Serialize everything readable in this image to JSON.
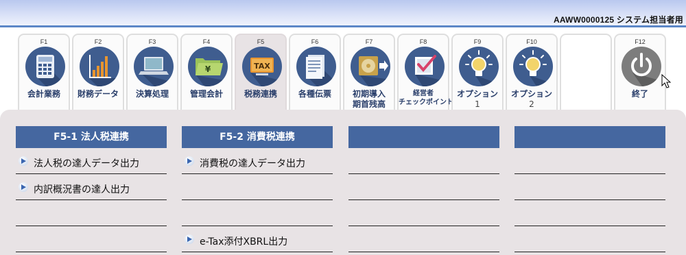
{
  "header": {
    "info": "AAWW0000125 システム担当者用"
  },
  "tabs": [
    {
      "key": "F1",
      "label": "会計業務",
      "icon": "calculator-icon"
    },
    {
      "key": "F2",
      "label": "財務データ",
      "icon": "bar-chart-icon"
    },
    {
      "key": "F3",
      "label": "決算処理",
      "icon": "laptop-icon"
    },
    {
      "key": "F4",
      "label": "管理会計",
      "icon": "yen-folder-icon"
    },
    {
      "key": "F5",
      "label": "税務連携",
      "icon": "tax-icon"
    },
    {
      "key": "F6",
      "label": "各種伝票",
      "icon": "document-icon"
    },
    {
      "key": "F7",
      "label": "初期導入",
      "label2": "期首残高",
      "icon": "disc-export-icon"
    },
    {
      "key": "F8",
      "label": "経営者",
      "label2": "チェックポイント",
      "icon": "checkbox-icon"
    },
    {
      "key": "F9",
      "label": "オプション",
      "label2": "1",
      "icon": "lightbulb-icon"
    },
    {
      "key": "F10",
      "label": "オプション",
      "label2": "2",
      "icon": "lightbulb-icon"
    },
    {
      "key": "F12",
      "label": "終了",
      "icon": "power-icon"
    }
  ],
  "colors": {
    "accent": "#4567a0",
    "header_border": "#5c87c7",
    "panel": "#e8e3e5"
  },
  "columns": [
    {
      "title": "F5-1 法人税連携",
      "rows": [
        "法人税の達人データ出力",
        "内訳概況書の達人出力",
        "",
        ""
      ]
    },
    {
      "title": "F5-2 消費税連携",
      "rows": [
        "消費税の達人データ出力",
        "",
        "",
        "e-Tax添付XBRL出力"
      ]
    },
    {
      "title": "",
      "rows": [
        "",
        "",
        "",
        ""
      ]
    },
    {
      "title": "",
      "rows": [
        "",
        "",
        "",
        ""
      ]
    }
  ]
}
